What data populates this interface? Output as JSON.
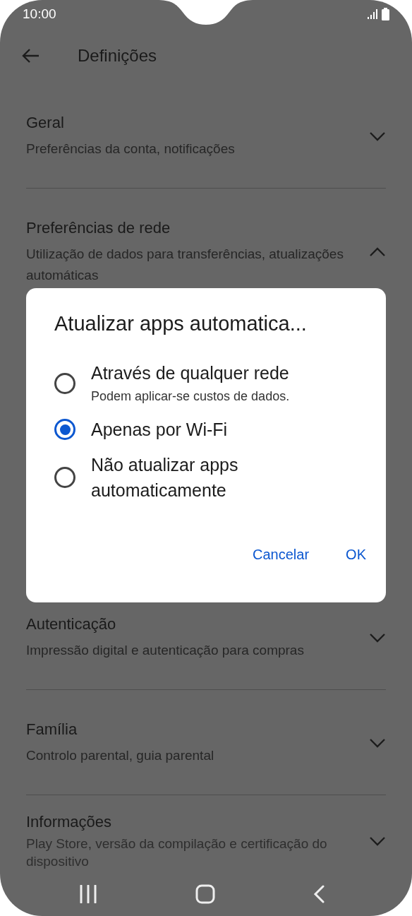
{
  "status_bar": {
    "time": "10:00"
  },
  "app_bar": {
    "title": "Definições"
  },
  "sections": [
    {
      "title": "Geral",
      "subtitle": "Preferências da conta, notificações",
      "expanded": false
    },
    {
      "title": "Preferências de rede",
      "subtitle": "Utilização de dados para transferências, atualizações automáticas",
      "expanded": true
    },
    {
      "title": "Autenticação",
      "subtitle": "Impressão digital e autenticação para compras",
      "expanded": false
    },
    {
      "title": "Família",
      "subtitle": "Controlo parental, guia parental",
      "expanded": false
    },
    {
      "title": "Informações",
      "subtitle": "Play Store, versão da compilação e certificação do dispositivo",
      "expanded": false
    }
  ],
  "dialog": {
    "title": "Atualizar apps automatica...",
    "options": [
      {
        "label": "Através de qualquer rede",
        "description": "Podem aplicar-se custos de dados.",
        "selected": false
      },
      {
        "label": "Apenas por Wi-Fi",
        "selected": true
      },
      {
        "label": "Não atualizar apps automaticamente",
        "selected": false
      }
    ],
    "buttons": [
      "Cancelar",
      "OK"
    ]
  }
}
